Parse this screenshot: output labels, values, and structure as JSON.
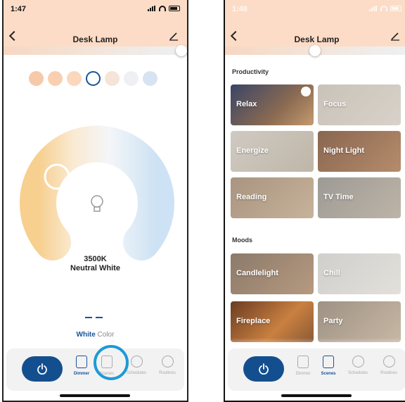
{
  "left": {
    "time": "1:47",
    "title": "Desk Lamp",
    "swatch_colors": [
      "#f6c9a8",
      "#f8cfb0",
      "#fad7bd",
      "#ffffff",
      "#f6e4d8",
      "#eef0f4",
      "#d8e3f2"
    ],
    "selected_swatch": 3,
    "kelvin": "3500K",
    "color_name": "Neutral White",
    "mode_white": "White",
    "mode_color": "Color",
    "tabs": [
      "Dimmer",
      "Scenes",
      "Schedules",
      "Routines"
    ],
    "active_tab": "Dimmer"
  },
  "right": {
    "time": "1:48",
    "title": "Desk Lamp",
    "sections": [
      {
        "title": "Productivity",
        "scenes": [
          "Relax",
          "Focus",
          "Energize",
          "Night Light",
          "Reading",
          "TV Time"
        ]
      },
      {
        "title": "Moods",
        "scenes": [
          "Candlelight",
          "Chill",
          "Fireplace",
          "Party"
        ]
      }
    ],
    "tabs": [
      "Dimmer",
      "Scenes",
      "Schedules",
      "Routines"
    ],
    "active_tab": "Scenes"
  },
  "colors": {
    "header_bg": "#fcdcc7",
    "accent_blue": "#16549a",
    "power_blue": "#134f8f",
    "highlight_ring": "#1d9ad6"
  },
  "icons": [
    "back-arrow-icon",
    "pencil-edit-icon",
    "lightbulb-icon",
    "power-icon",
    "dimmer-icon",
    "scenes-clapperboard-icon",
    "schedules-clock-icon",
    "routines-icon",
    "signal-icon",
    "wifi-icon",
    "battery-icon"
  ]
}
